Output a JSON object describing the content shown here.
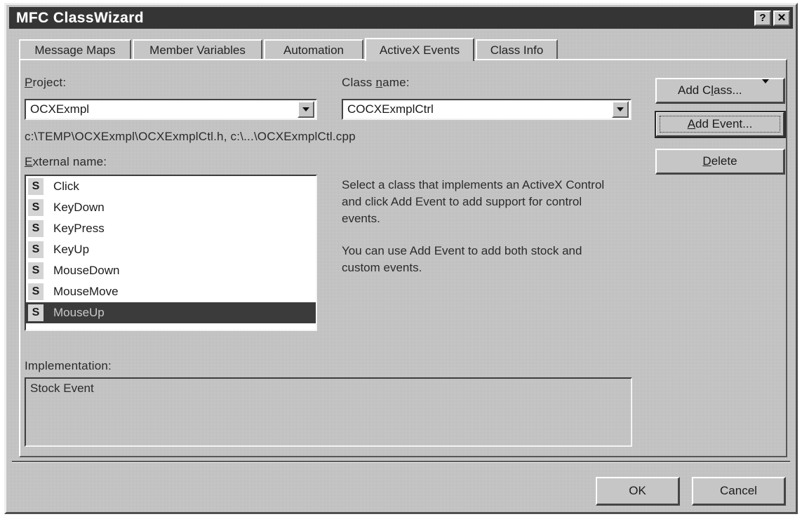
{
  "window": {
    "title": "MFC ClassWizard",
    "help_button": "?",
    "close_button": "✕",
    "help_icon_name": "help-icon",
    "close_icon_name": "close-icon"
  },
  "tabs": [
    {
      "label": "Message Maps",
      "selected": false
    },
    {
      "label": "Member Variables",
      "selected": false
    },
    {
      "label": "Automation",
      "selected": false
    },
    {
      "label": "ActiveX Events",
      "selected": true
    },
    {
      "label": "Class Info",
      "selected": false
    }
  ],
  "project": {
    "label": "Project:",
    "label_mnemonic": "P",
    "label_rest": "roject:",
    "value": "OCXExmpl",
    "dropdown_icon": "chevron-down-icon"
  },
  "class_name": {
    "label_pre": "Class ",
    "label_mnemonic": "n",
    "label_rest": "ame:",
    "value": "COCXExmplCtrl",
    "dropdown_icon": "chevron-down-icon"
  },
  "file_path": "c:\\TEMP\\OCXExmpl\\OCXExmplCtl.h, c:\\...\\OCXExmplCtl.cpp",
  "external_name": {
    "label_mnemonic": "E",
    "label_rest": "xternal name:"
  },
  "events": [
    {
      "badge": "S",
      "name": "Click",
      "selected": false
    },
    {
      "badge": "S",
      "name": "KeyDown",
      "selected": false
    },
    {
      "badge": "S",
      "name": "KeyPress",
      "selected": false
    },
    {
      "badge": "S",
      "name": "KeyUp",
      "selected": false
    },
    {
      "badge": "S",
      "name": "MouseDown",
      "selected": false
    },
    {
      "badge": "S",
      "name": "MouseMove",
      "selected": false
    },
    {
      "badge": "S",
      "name": "MouseUp",
      "selected": true
    }
  ],
  "description": {
    "paragraph1": "Select a class that implements an ActiveX Control and click Add Event to add support for control events.",
    "paragraph2": "You can use Add Event to add both stock and custom events."
  },
  "implementation": {
    "label": "Implementation:",
    "value": "Stock Event"
  },
  "side_buttons": {
    "add_class_pre": "Add C",
    "add_class_mnemonic": "l",
    "add_class_rest": "ass...",
    "add_class_arrow_icon": "chevron-down-icon",
    "add_event_mnemonic": "A",
    "add_event_rest": "dd Event...",
    "delete_mnemonic": "D",
    "delete_rest": "elete"
  },
  "bottom_buttons": {
    "ok": "OK",
    "cancel": "Cancel"
  },
  "colors": {
    "face": "#c6c6c6",
    "titlebar": "#353535",
    "selection": "#3b3b3b",
    "selection_text": "#c8c8c8",
    "field_bg": "#ffffff",
    "text": "#1c1c1c"
  }
}
